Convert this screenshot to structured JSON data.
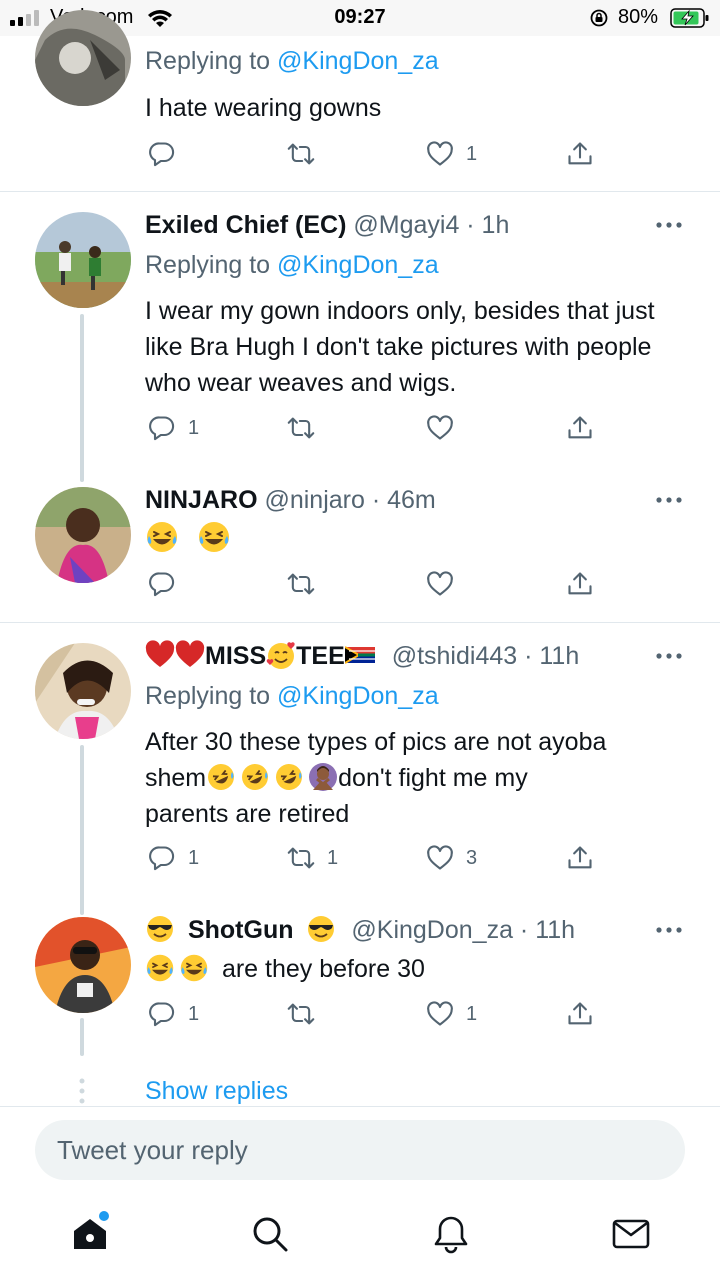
{
  "status_bar": {
    "carrier": "Vodacom",
    "time": "09:27",
    "battery": "80%"
  },
  "tweets": [
    {
      "reply_prefix": "Replying to ",
      "reply_to": "@KingDon_za",
      "text": "I hate wearing gowns",
      "replies": "",
      "retweets": "",
      "likes": "1"
    },
    {
      "name": "Exiled Chief (EC)",
      "handle": "@Mgayi4 · 1h",
      "reply_prefix": "Replying to ",
      "reply_to": "@KingDon_za",
      "text": "I wear my gown indoors only, besides that just like Bra Hugh I don't take pictures with people who wear weaves and wigs.",
      "replies": "1",
      "retweets": "",
      "likes": ""
    },
    {
      "name": "NINJARO",
      "handle": "@ninjaro · 46m",
      "emojis": [
        "laughing-tears",
        "laughing-tears"
      ],
      "replies": "",
      "retweets": "",
      "likes": ""
    },
    {
      "name": "MISS",
      "name_part2": "TEE",
      "handle": "@tshidi443 · 11h",
      "reply_prefix": "Replying to ",
      "reply_to": "@KingDon_za",
      "text_line1": "After 30 these types of pics are not ayoba",
      "text_line2a": "shem",
      "text_line2b": "don't fight me my",
      "text_line3": "parents are retired",
      "replies": "1",
      "retweets": "1",
      "likes": "3"
    },
    {
      "name": "ShotGun",
      "handle": "@KingDon_za · 11h",
      "text": "are they before 30",
      "replies": "1",
      "retweets": "",
      "likes": "1"
    }
  ],
  "show_replies": "Show replies",
  "composer": {
    "placeholder": "Tweet your reply"
  },
  "tabbar": {
    "items": [
      "home-icon",
      "search-icon",
      "notifications-icon",
      "messages-icon"
    ]
  },
  "colors": {
    "accent": "#1d9bf0",
    "text_secondary": "#536471",
    "thread_line": "#cfd9de"
  }
}
